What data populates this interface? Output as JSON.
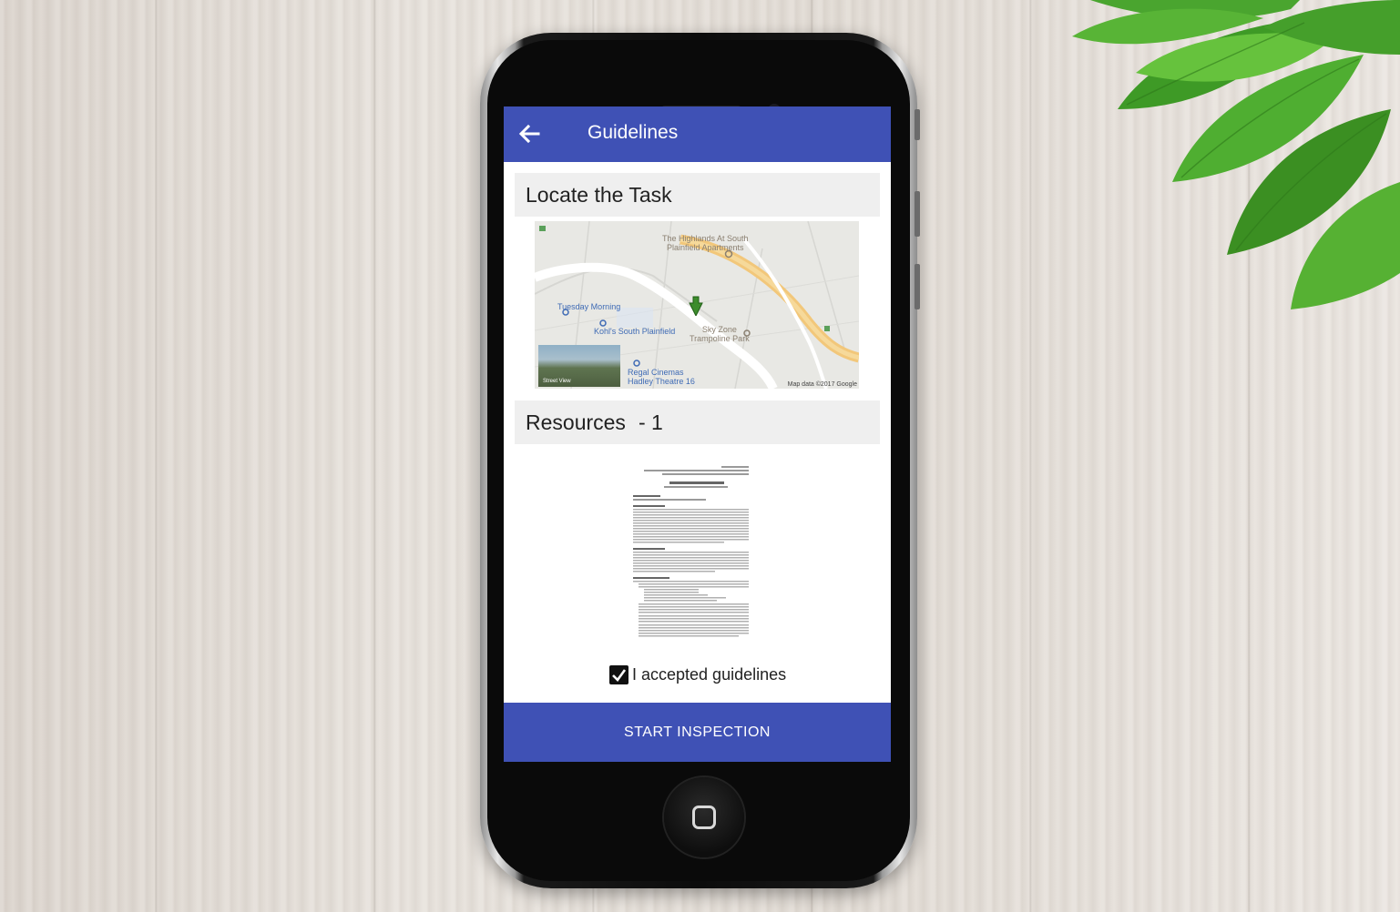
{
  "appbar": {
    "title": "Guidelines",
    "back_icon": "arrow-left-icon",
    "color": "#3f51b5"
  },
  "location_section": {
    "heading": "Locate the Task",
    "map": {
      "labels": [
        "The Highlands At South",
        "Plainfield Apartments",
        "Tuesday Morning",
        "Kohl's South Plainfield",
        "Sky Zone",
        "Trampoline Park",
        "Regal Cinemas",
        "Hadley Theatre 16"
      ],
      "street_view_label": "Street View",
      "attribution": "Map data ©2017 Google",
      "marker_icon": "map-pin-icon"
    }
  },
  "resources_section": {
    "heading": "Resources",
    "count": "- 1"
  },
  "acceptance": {
    "label": "I accepted guidelines",
    "checked": true
  },
  "start_button": {
    "label": "START INSPECTION"
  }
}
